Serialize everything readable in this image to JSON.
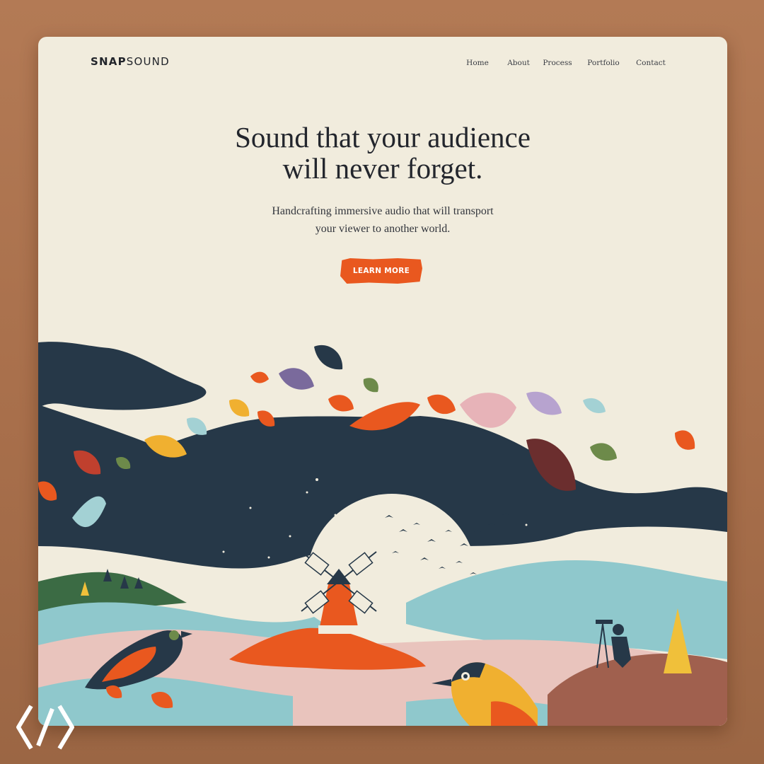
{
  "brand": {
    "bold_part": "SNAP",
    "light_part": "SOUND"
  },
  "nav": {
    "items": [
      {
        "label": "Home"
      },
      {
        "label": "About"
      },
      {
        "label": "Process"
      },
      {
        "label": "Portfolio"
      },
      {
        "label": "Contact"
      }
    ]
  },
  "hero": {
    "title_line1": "Sound that your audience",
    "title_line2": "will never forget.",
    "subtitle_line1": "Handcrafting immersive audio that will transport",
    "subtitle_line2": "your viewer to another world.",
    "cta_label": "LEARN MORE"
  },
  "colors": {
    "page_background": "#b37a55",
    "card_background": "#f1ecdd",
    "accent": "#e9581f",
    "navy": "#263848",
    "water": "#8fc8cc",
    "pink": "#e9c4bd"
  },
  "illustration": {
    "icons": [
      "windmill-icon",
      "moon-icon",
      "bird-flock-icon",
      "sound-recordist-icon",
      "left-bird-icon",
      "right-bird-icon",
      "autumn-leaves-icon",
      "trees-icon"
    ]
  }
}
